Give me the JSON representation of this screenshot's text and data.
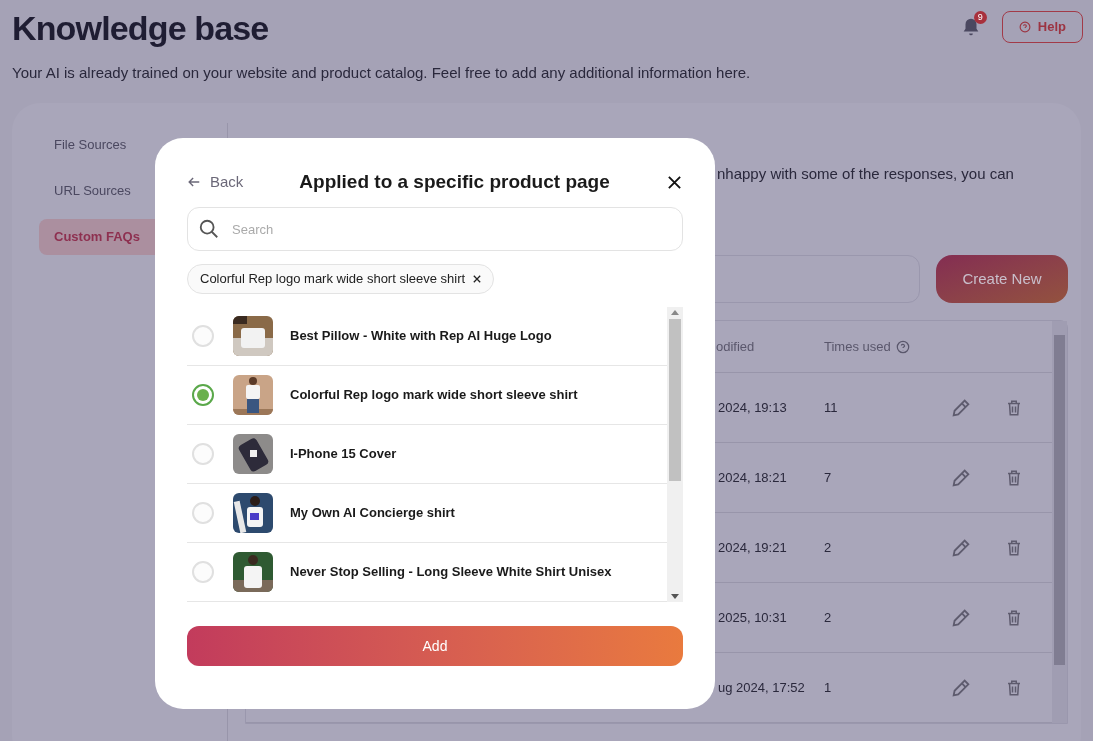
{
  "header": {
    "title": "Knowledge base",
    "subtitle": "Your AI is already trained on your website and product catalog. Feel free to add any additional information here.",
    "notification_count": "9",
    "help_button": "Help"
  },
  "sidebar": {
    "items": [
      {
        "label": "File Sources",
        "selected": false
      },
      {
        "label": "URL Sources",
        "selected": false
      },
      {
        "label": "Custom FAQs",
        "selected": true
      }
    ]
  },
  "content": {
    "description": "nhappy with some of the responses, you can",
    "create_button": "Create New",
    "table": {
      "columns": [
        "odified",
        "Times used"
      ],
      "rows": [
        {
          "modified": "2024, 19:13",
          "times_used": "11"
        },
        {
          "modified": "2024, 18:21",
          "times_used": "7"
        },
        {
          "modified": "2024, 19:21",
          "times_used": "2"
        },
        {
          "modified": "2025, 10:31",
          "times_used": "2"
        },
        {
          "modified": "ug 2024, 17:52",
          "times_used": "1"
        }
      ]
    }
  },
  "modal": {
    "back": "Back",
    "title": "Applied to a specific product page",
    "search": {
      "placeholder": "Search"
    },
    "chips": [
      {
        "label": "Colorful Rep logo mark wide short sleeve shirt"
      }
    ],
    "products": [
      {
        "name": "Best Pillow - White with Rep AI Huge Logo",
        "selected": false
      },
      {
        "name": "Colorful Rep logo mark wide short sleeve shirt",
        "selected": true
      },
      {
        "name": "I-Phone 15 Cover",
        "selected": false
      },
      {
        "name": "My Own AI Concierge shirt",
        "selected": false
      },
      {
        "name": "Never Stop Selling - Long Sleeve White Shirt Unisex",
        "selected": false
      }
    ],
    "add_button": "Add"
  }
}
